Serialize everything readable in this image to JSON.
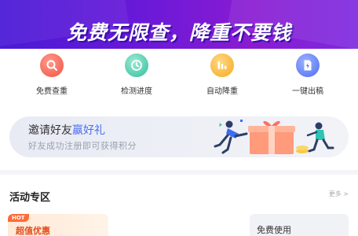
{
  "banner": {
    "title": "免费无限查，降重不要钱"
  },
  "actions": [
    {
      "label": "免费查重",
      "icon": "search-icon",
      "color": "#f0503f"
    },
    {
      "label": "检测进度",
      "icon": "clock-icon",
      "color": "#2fbf9a"
    },
    {
      "label": "自动降重",
      "icon": "bar-chart-icon",
      "color": "#f7a91e"
    },
    {
      "label": "一键出稿",
      "icon": "document-flash-icon",
      "color": "#4d6cf2"
    }
  ],
  "invite": {
    "title_prefix": "邀请好友",
    "title_highlight": "赢好礼",
    "subtitle": "好友成功注册即可获得积分",
    "accent": "#4a6ef0"
  },
  "activity": {
    "title": "活动专区",
    "more": "更多",
    "card_left": {
      "badge": "HOT",
      "title": "超值优惠"
    },
    "card_right": {
      "title": "免费使用"
    }
  }
}
